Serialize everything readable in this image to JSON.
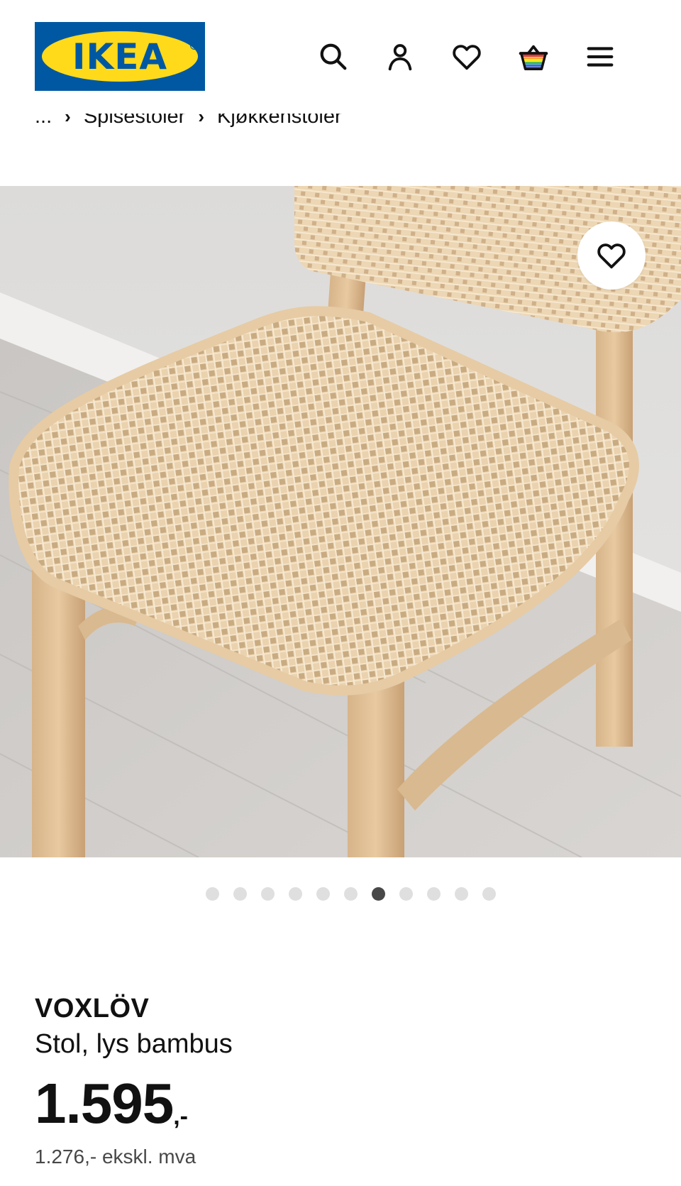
{
  "header": {
    "logo_text": "IKEA",
    "icons": [
      "search-icon",
      "account-icon",
      "heart-icon",
      "basket-icon",
      "menu-icon"
    ]
  },
  "breadcrumb": {
    "ellipsis": "...",
    "items": [
      "Spisestoler",
      "Kjøkkenstoler"
    ]
  },
  "gallery": {
    "image": "Bamboo chair with woven rattan seat and back",
    "dot_count": 11,
    "active_index": 6,
    "favorite_icon": "heart-icon"
  },
  "product": {
    "name": "VOXLÖV",
    "description": "Stol, lys bambus",
    "price": "1.595",
    "price_suffix": ",-",
    "price_ex_vat": "1.276,- ekskl. mva"
  },
  "colors": {
    "brand_blue": "#0058a3",
    "brand_yellow": "#ffda1a",
    "text": "#111111",
    "dot_inactive": "#dfdfdf",
    "dot_active": "#484848"
  }
}
